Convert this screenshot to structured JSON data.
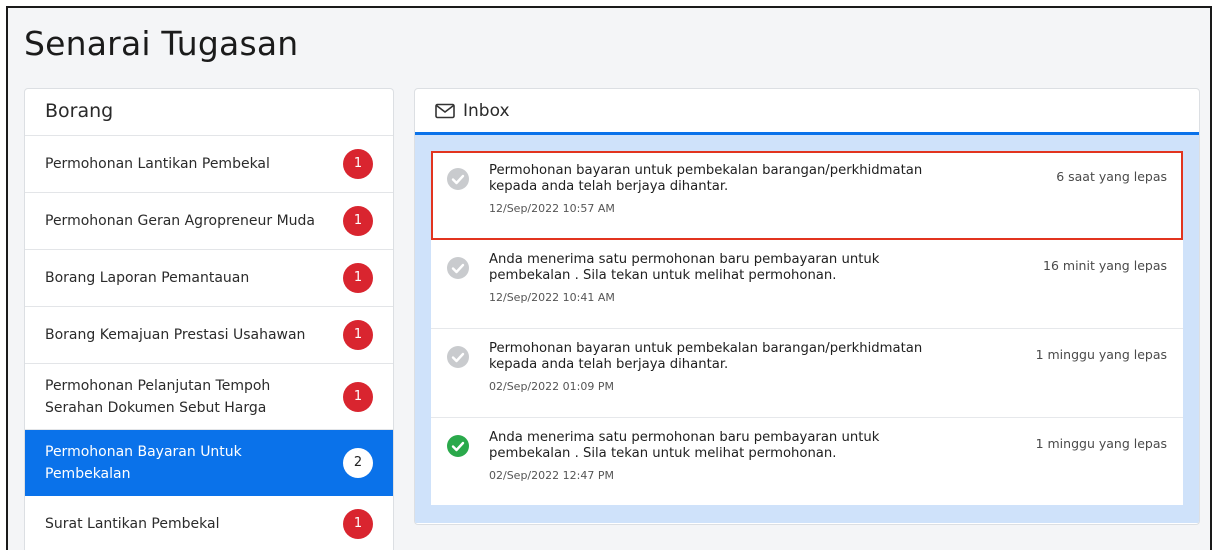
{
  "page": {
    "title": "Senarai Tugasan"
  },
  "borang": {
    "header": "Borang",
    "items": [
      {
        "label": "Permohonan Lantikan Pembekal",
        "count": "1"
      },
      {
        "label": "Permohonan Geran Agropreneur Muda",
        "count": "1"
      },
      {
        "label": "Borang Laporan Pemantauan",
        "count": "1"
      },
      {
        "label": "Borang Kemajuan Prestasi Usahawan",
        "count": "1"
      },
      {
        "label": "Permohonan Pelanjutan Tempoh Serahan Dokumen Sebut Harga",
        "count": "1"
      },
      {
        "label": "Permohonan Bayaran Untuk Pembekalan",
        "count": "2",
        "active": true
      },
      {
        "label": "Surat Lantikan Pembekal",
        "count": "1"
      }
    ]
  },
  "inbox": {
    "header": "Inbox",
    "messages": [
      {
        "text": "Permohonan bayaran untuk pembekalan barangan/perkhidmatan kepada anda telah berjaya dihantar.",
        "date": "12/Sep/2022 10:57 AM",
        "ago": "6 saat yang lepas",
        "status": "read"
      },
      {
        "text": "Anda menerima satu permohonan baru pembayaran untuk pembekalan . Sila tekan untuk melihat permohonan.",
        "date": "12/Sep/2022 10:41 AM",
        "ago": "16 minit yang lepas",
        "status": "read"
      },
      {
        "text": "Permohonan bayaran untuk pembekalan barangan/perkhidmatan kepada anda telah berjaya dihantar.",
        "date": "02/Sep/2022 01:09 PM",
        "ago": "1 minggu yang lepas",
        "status": "read"
      },
      {
        "text": "Anda menerima satu permohonan baru pembayaran untuk pembekalan . Sila tekan untuk melihat permohonan.",
        "date": "02/Sep/2022 12:47 PM",
        "ago": "1 minggu yang lepas",
        "status": "done"
      }
    ]
  },
  "colors": {
    "accent": "#0a72ea",
    "badge": "#d9252f",
    "inbox_bg": "#cfe2fa",
    "check_grey": "#c9cbce",
    "check_green": "#2aa94b",
    "highlight": "#e2341f"
  },
  "icons": {
    "inbox": "envelope-icon",
    "read": "check-circle-grey-icon",
    "done": "check-circle-green-icon"
  }
}
